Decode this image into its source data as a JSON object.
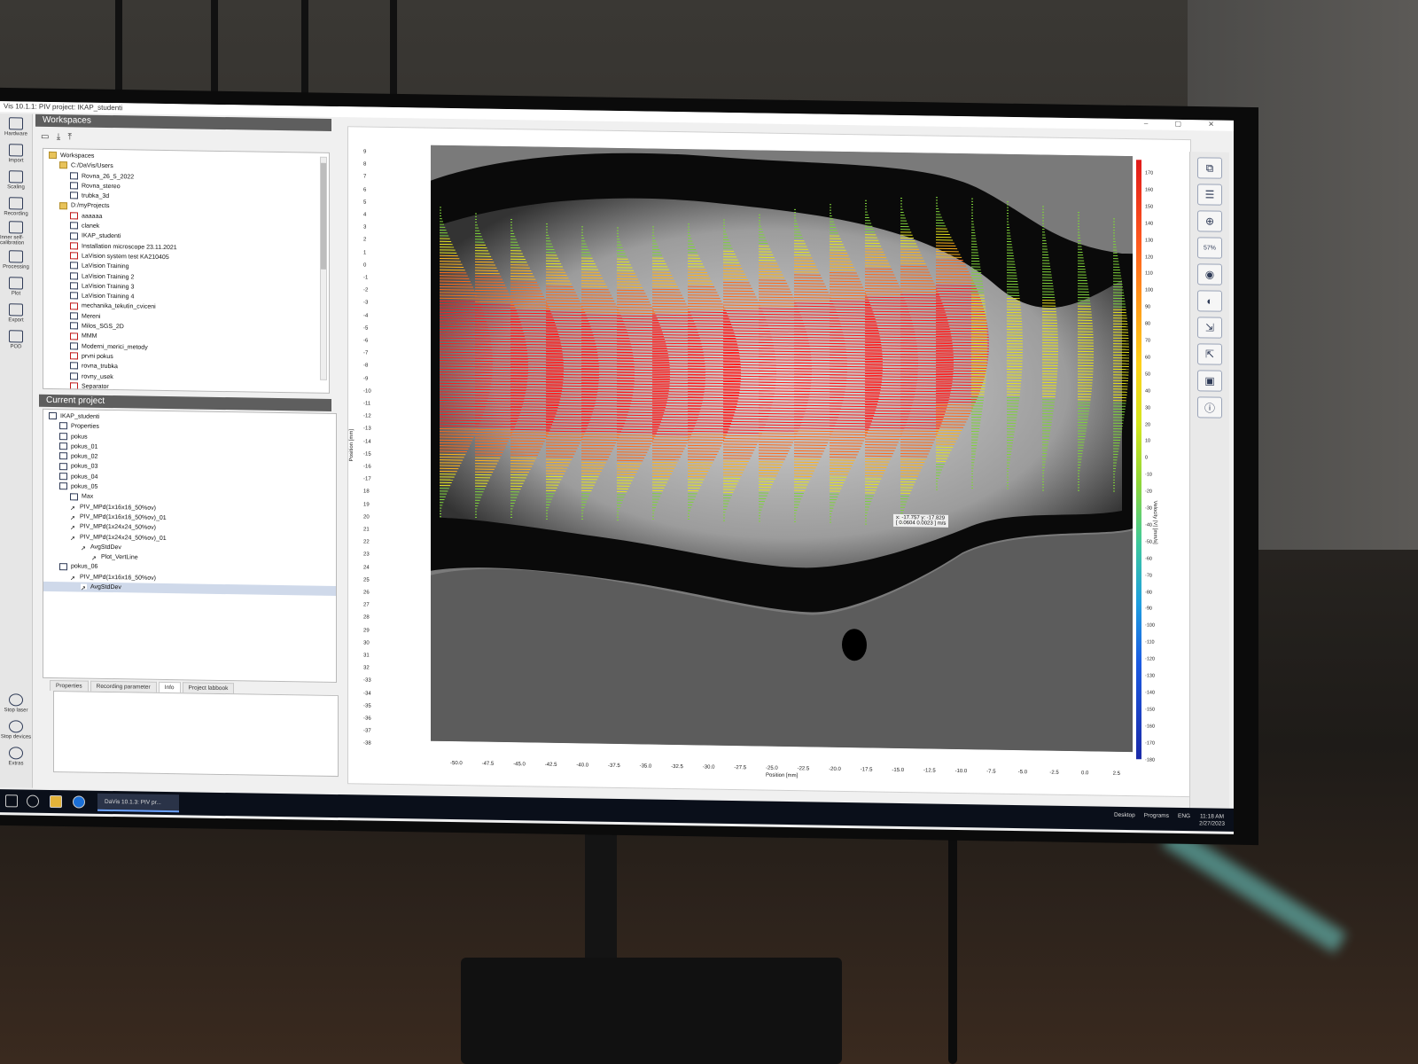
{
  "window": {
    "title": "Vis 10.1.1: PIV project: IKAP_studenti"
  },
  "left_toolbar": [
    "Hardware",
    "Import",
    "Scaling",
    "Recording",
    "Inner self-calibration",
    "Processing",
    "Plot",
    "Export",
    "POD"
  ],
  "left_bottom": [
    "Stop laser",
    "Stop devices",
    "Extras"
  ],
  "workspaces": {
    "header": "Workspaces",
    "items": [
      {
        "label": "Workspaces",
        "depth": 0,
        "icon": "folder"
      },
      {
        "label": "C:/DaVis/Users",
        "depth": 1,
        "icon": "folder"
      },
      {
        "label": "Rovna_26_5_2022",
        "depth": 2,
        "icon": "doc"
      },
      {
        "label": "Rovna_stereo",
        "depth": 2,
        "icon": "doc"
      },
      {
        "label": "trubka_3d",
        "depth": 2,
        "icon": "doc"
      },
      {
        "label": "D:/myProjects",
        "depth": 1,
        "icon": "folder"
      },
      {
        "label": "aaaaaa",
        "depth": 2,
        "icon": "red"
      },
      {
        "label": "clanek",
        "depth": 2,
        "icon": "doc"
      },
      {
        "label": "IKAP_studenti",
        "depth": 2,
        "icon": "doc"
      },
      {
        "label": "Installation microscope 23.11.2021",
        "depth": 2,
        "icon": "red"
      },
      {
        "label": "LaVision system test KA210405",
        "depth": 2,
        "icon": "red"
      },
      {
        "label": "LaVision Training",
        "depth": 2,
        "icon": "doc"
      },
      {
        "label": "LaVision Training 2",
        "depth": 2,
        "icon": "doc"
      },
      {
        "label": "LaVision Training 3",
        "depth": 2,
        "icon": "doc"
      },
      {
        "label": "LaVision Training 4",
        "depth": 2,
        "icon": "doc"
      },
      {
        "label": "mechanika_tekutin_cviceni",
        "depth": 2,
        "icon": "red"
      },
      {
        "label": "Mereni",
        "depth": 2,
        "icon": "doc"
      },
      {
        "label": "Milos_SGS_2D",
        "depth": 2,
        "icon": "doc"
      },
      {
        "label": "MMM",
        "depth": 2,
        "icon": "red"
      },
      {
        "label": "Moderni_merici_metody",
        "depth": 2,
        "icon": "doc"
      },
      {
        "label": "prvni pokus",
        "depth": 2,
        "icon": "red"
      },
      {
        "label": "rovna_trubka",
        "depth": 2,
        "icon": "doc"
      },
      {
        "label": "rovny_usek",
        "depth": 2,
        "icon": "doc"
      },
      {
        "label": "Separator",
        "depth": 2,
        "icon": "red"
      }
    ]
  },
  "project": {
    "header": "Current project",
    "items": [
      {
        "label": "IKAP_studenti",
        "depth": 0,
        "icon": "doc"
      },
      {
        "label": "Properties",
        "depth": 1,
        "icon": "doc"
      },
      {
        "label": "pokus",
        "depth": 1,
        "icon": "doc"
      },
      {
        "label": "pokus_01",
        "depth": 1,
        "icon": "doc"
      },
      {
        "label": "pokus_02",
        "depth": 1,
        "icon": "doc"
      },
      {
        "label": "pokus_03",
        "depth": 1,
        "icon": "doc"
      },
      {
        "label": "pokus_04",
        "depth": 1,
        "icon": "doc"
      },
      {
        "label": "pokus_05",
        "depth": 1,
        "icon": "doc"
      },
      {
        "label": "Max",
        "depth": 2,
        "icon": "doc"
      },
      {
        "label": "PIV_MPd(1x16x16_50%ov)",
        "depth": 2,
        "icon": "ar"
      },
      {
        "label": "PIV_MPd(1x16x16_50%ov)_01",
        "depth": 2,
        "icon": "ar"
      },
      {
        "label": "PIV_MPd(1x24x24_50%ov)",
        "depth": 2,
        "icon": "ar"
      },
      {
        "label": "PIV_MPd(1x24x24_50%ov)_01",
        "depth": 2,
        "icon": "ar"
      },
      {
        "label": "AvgStdDev",
        "depth": 3,
        "icon": "ar"
      },
      {
        "label": "Plot_VertLine",
        "depth": 4,
        "icon": "ar"
      },
      {
        "label": "pokus_06",
        "depth": 1,
        "icon": "doc"
      },
      {
        "label": "PIV_MPd(1x16x16_50%ov)",
        "depth": 2,
        "icon": "ar"
      },
      {
        "label": "AvgStdDev",
        "depth": 3,
        "icon": "ar",
        "selected": true
      }
    ]
  },
  "bottom_tabs": [
    "Properties",
    "Recording parameter",
    "Info",
    "Project labbook"
  ],
  "plot": {
    "y_axis_label": "Position [mm]",
    "x_axis_label": "Position [mm]",
    "colorbar_label": "Velocity |V| [mm/s]",
    "y_ticks": [
      "9",
      "8",
      "7",
      "6",
      "5",
      "4",
      "3",
      "2",
      "1",
      "0",
      "-1",
      "-2",
      "-3",
      "-4",
      "-5",
      "-6",
      "-7",
      "-8",
      "-9",
      "-10",
      "-11",
      "-12",
      "-13",
      "-14",
      "-15",
      "-16",
      "-17",
      "18",
      "19",
      "20",
      "21",
      "22",
      "23",
      "24",
      "25",
      "26",
      "27",
      "28",
      "29",
      "30",
      "31",
      "32",
      "-33",
      "-34",
      "-35",
      "-36",
      "-37",
      "-38"
    ],
    "x_ticks": [
      "-50.0",
      "-47.5",
      "-45.0",
      "-42.5",
      "-40.0",
      "-37.5",
      "-35.0",
      "-32.5",
      "-30.0",
      "-27.5",
      "-25.0",
      "-22.5",
      "-20.0",
      "-17.5",
      "-15.0",
      "-12.5",
      "-10.0",
      "-7.5",
      "-5.0",
      "-2.5",
      "0.0",
      "2.5"
    ],
    "colorbar_ticks": [
      "170",
      "160",
      "150",
      "140",
      "130",
      "120",
      "110",
      "100",
      "90",
      "80",
      "70",
      "60",
      "50",
      "40",
      "30",
      "20",
      "10",
      "0",
      "-10",
      "-20",
      "-30",
      "-40",
      "-50",
      "-60",
      "-70",
      "-80",
      "-90",
      "-100",
      "-110",
      "-120",
      "-130",
      "-140",
      "-150",
      "-160",
      "-170",
      "-180"
    ],
    "cursor_tooltip": "x: -17.757 y: -17.829\n[ 0.0604 0.0023 ] m/s"
  },
  "right_toolbar": {
    "zoom": "57%"
  },
  "taskbar": {
    "app_label": "DaVis 10.1.3: PIV pr...",
    "tray": [
      "Desktop",
      "Programs",
      "ENG"
    ],
    "time": "11:18 AM",
    "date": "2/27/2023"
  }
}
